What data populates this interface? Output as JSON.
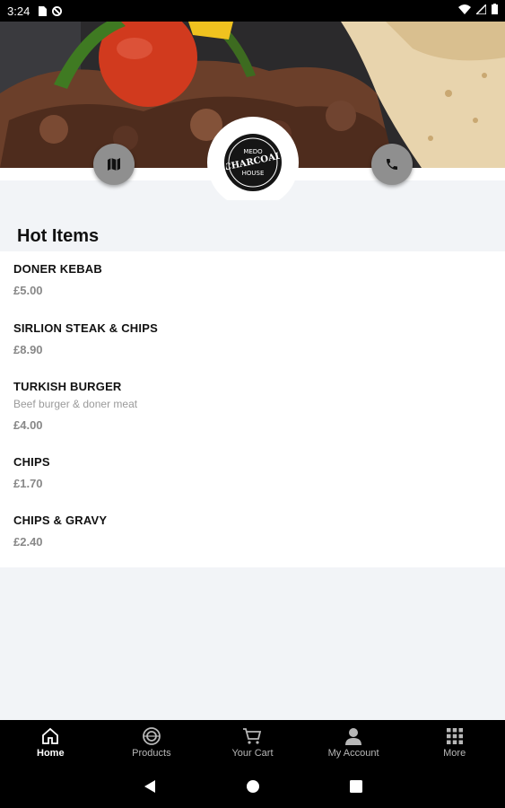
{
  "status_bar": {
    "time": "3:24"
  },
  "section": {
    "title": "Hot Items"
  },
  "items": [
    {
      "name": "DONER KEBAB",
      "description": "",
      "price": "£5.00"
    },
    {
      "name": "SIRLION STEAK & CHIPS",
      "description": "",
      "price": "£8.90"
    },
    {
      "name": "TURKISH BURGER",
      "description": "Beef burger & doner meat",
      "price": "£4.00"
    },
    {
      "name": "CHIPS",
      "description": "",
      "price": "£1.70"
    },
    {
      "name": "CHIPS & GRAVY",
      "description": "",
      "price": "£2.40"
    }
  ],
  "logo": {
    "text": "MEDO CHARCOAL HOUSE"
  },
  "bottom_nav": [
    {
      "label": "Home",
      "icon": "home-icon",
      "active": true
    },
    {
      "label": "Products",
      "icon": "products-icon",
      "active": false
    },
    {
      "label": "Your Cart",
      "icon": "cart-icon",
      "active": false
    },
    {
      "label": "My Account",
      "icon": "account-icon",
      "active": false
    },
    {
      "label": "More",
      "icon": "grid-icon",
      "active": false
    }
  ],
  "colors": {
    "accent": "#000000",
    "price": "#888888",
    "button": "#8f8f8f"
  }
}
